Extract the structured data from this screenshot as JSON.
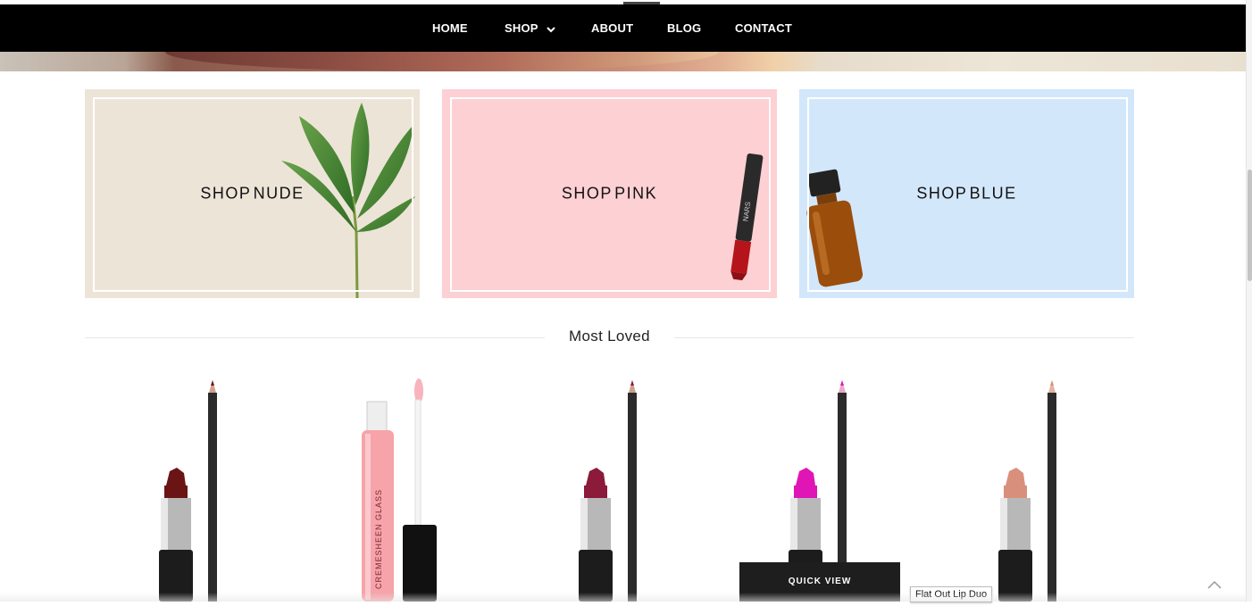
{
  "nav": {
    "items": [
      {
        "label": "HOME"
      },
      {
        "label": "SHOP"
      },
      {
        "label": "ABOUT"
      },
      {
        "label": "BLOG"
      },
      {
        "label": "CONTACT"
      }
    ]
  },
  "banners": [
    {
      "label": "SHOP NUDE",
      "color": "#ede4d8",
      "image": "leaf-plant-icon"
    },
    {
      "label": "SHOP PINK",
      "color": "#fdd0d3",
      "image": "lip-pencil-icon"
    },
    {
      "label": "SHOP BLUE",
      "color": "#d3e7fb",
      "image": "amber-bottle-icon"
    }
  ],
  "section": {
    "title": "Most Loved"
  },
  "products": [
    {
      "image": "lipstick-and-liner",
      "shade": "#6b1416"
    },
    {
      "image": "lipglass-tube",
      "shade": "#f6a3aa"
    },
    {
      "image": "lipstick-and-liner",
      "shade": "#8c1a3a"
    },
    {
      "image": "lipstick-and-liner",
      "shade": "#e015b6"
    },
    {
      "image": "lipstick-and-liner",
      "shade": "#d8907c"
    }
  ],
  "overlay": {
    "quick_view_label": "QUICK VIEW",
    "tooltip": "Flat Out Lip Duo"
  },
  "icons": {
    "back_to_top": "chevron-up-icon",
    "shop_dropdown": "chevron-down-icon"
  }
}
